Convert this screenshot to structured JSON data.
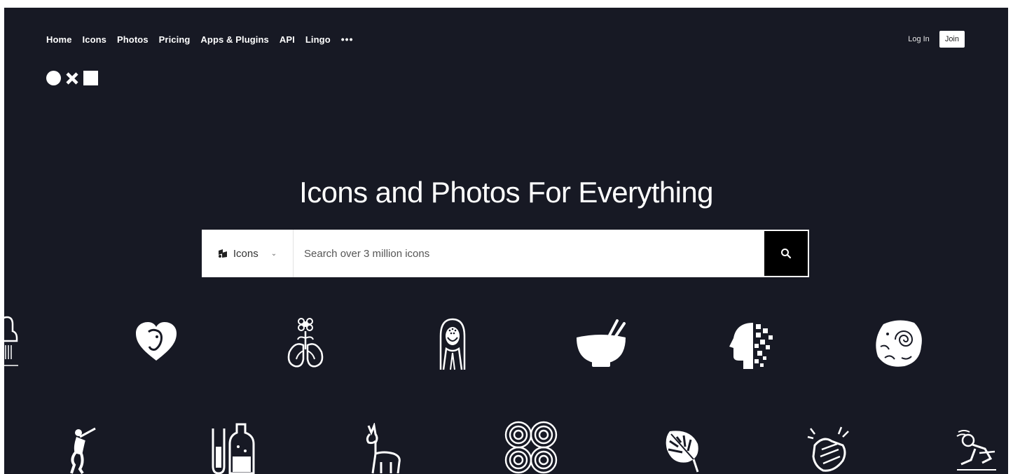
{
  "nav": {
    "items": [
      {
        "label": "Home"
      },
      {
        "label": "Icons"
      },
      {
        "label": "Photos"
      },
      {
        "label": "Pricing"
      },
      {
        "label": "Apps & Plugins"
      },
      {
        "label": "API"
      },
      {
        "label": "Lingo"
      }
    ],
    "more_label": "•••"
  },
  "auth": {
    "login_label": "Log In",
    "join_label": "Join"
  },
  "hero": {
    "title": "Icons and Photos For Everything"
  },
  "search": {
    "type_label": "Icons",
    "placeholder": "Search over 3 million icons",
    "value": ""
  },
  "colors": {
    "background": "#171924",
    "foreground": "#ffffff",
    "search_button": "#000000"
  },
  "showcase_icons": [
    "shower-icon",
    "heart-face-icon",
    "flower-lungs-icon",
    "woman-portrait-icon",
    "bowl-chopsticks-icon",
    "pixel-head-icon",
    "fossil-ammonite-icon",
    "dancer-icon",
    "test-tube-bottle-icon",
    "llama-icon",
    "spiral-pattern-icon",
    "monstera-leaf-icon",
    "clapping-hands-icon",
    "skateboarder-icon"
  ]
}
